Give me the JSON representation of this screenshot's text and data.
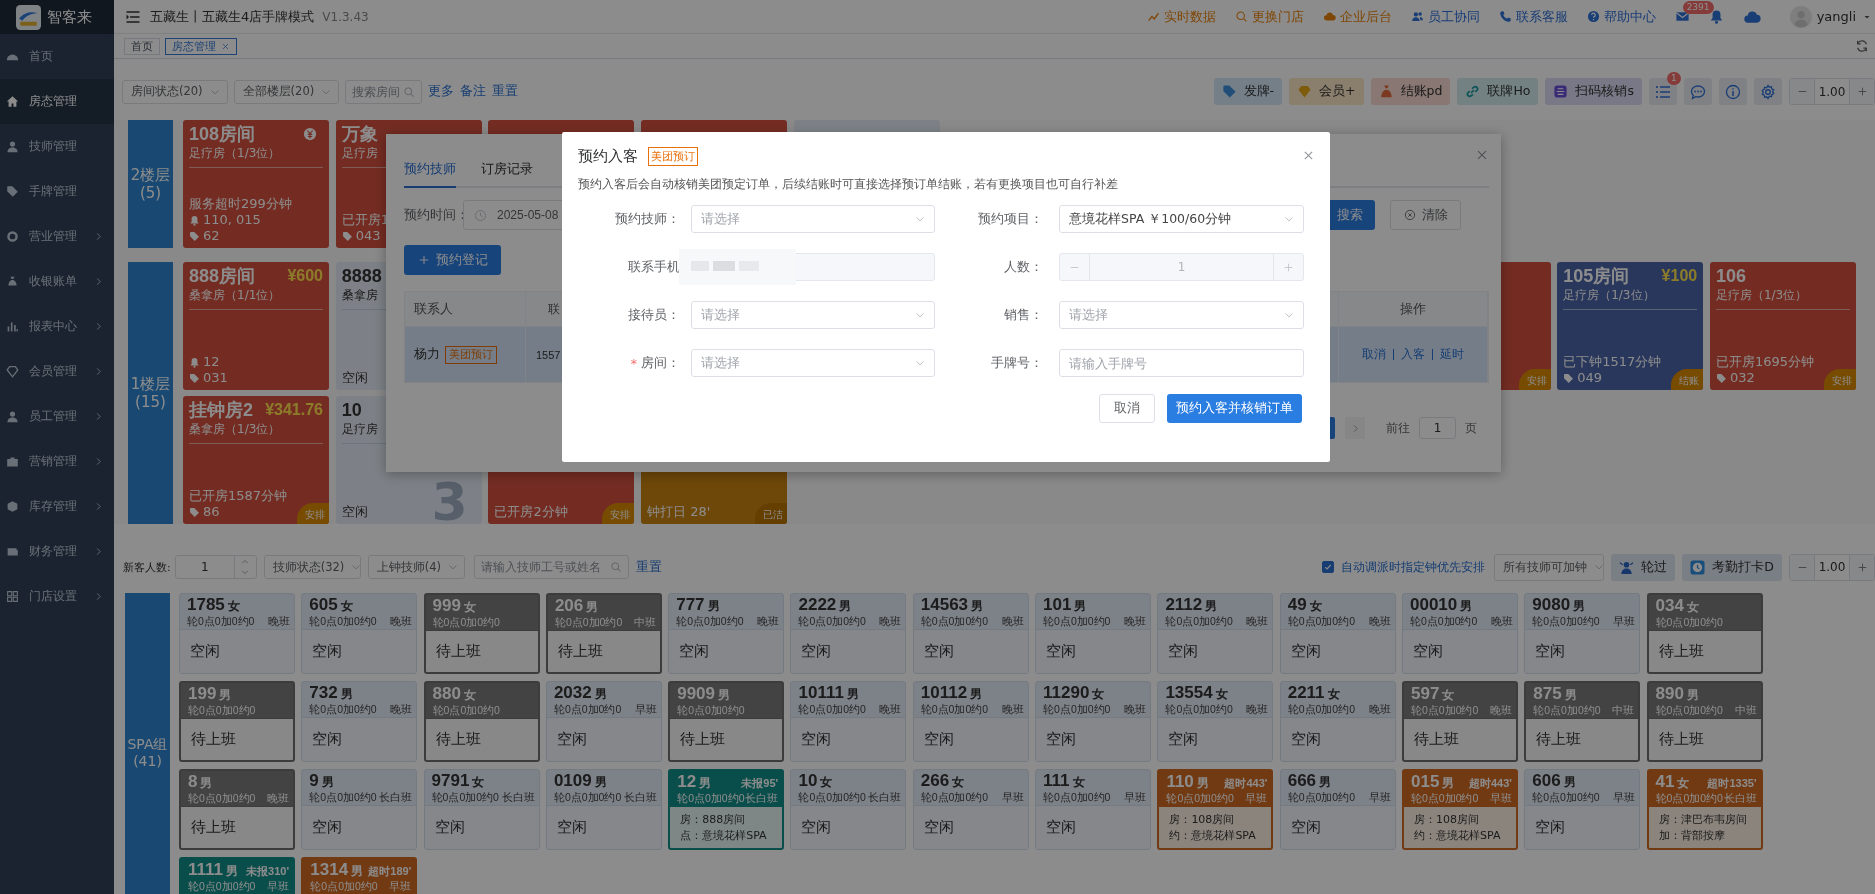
{
  "sidebar": {
    "brand": "智客来",
    "items": [
      {
        "label": "首页",
        "selected": false,
        "expandable": false
      },
      {
        "label": "房态管理",
        "selected": true,
        "expandable": false
      },
      {
        "label": "技师管理",
        "selected": false,
        "expandable": false
      },
      {
        "label": "手牌管理",
        "selected": false,
        "expandable": false
      },
      {
        "label": "营业管理",
        "selected": false,
        "expandable": true
      },
      {
        "label": "收银账单",
        "selected": false,
        "expandable": true
      },
      {
        "label": "报表中心",
        "selected": false,
        "expandable": true
      },
      {
        "label": "会员管理",
        "selected": false,
        "expandable": true
      },
      {
        "label": "员工管理",
        "selected": false,
        "expandable": true
      },
      {
        "label": "营销管理",
        "selected": false,
        "expandable": true
      },
      {
        "label": "库存管理",
        "selected": false,
        "expandable": true
      },
      {
        "label": "财务管理",
        "selected": false,
        "expandable": true
      },
      {
        "label": "门店设置",
        "selected": false,
        "expandable": true
      }
    ]
  },
  "header": {
    "title": "五藏生丨五藏生4店手牌模式",
    "version": "V1.3.43",
    "links": [
      {
        "label": "实时数据"
      },
      {
        "label": "更换门店"
      },
      {
        "label": "企业后台"
      },
      {
        "label": "员工协同"
      },
      {
        "label": "联系客服"
      },
      {
        "label": "帮助中心"
      }
    ],
    "mail_badge": "2391",
    "user": "yangli"
  },
  "tabs": [
    {
      "label": "首页",
      "selected": false,
      "closable": false
    },
    {
      "label": "房态管理",
      "selected": true,
      "closable": true
    }
  ],
  "room_filters": {
    "selects": [
      "房间状态(20)",
      "全部楼层(20)"
    ],
    "search_placeholder": "搜索房间",
    "links": [
      "更多",
      "备注",
      "重置"
    ]
  },
  "room_tools": [
    {
      "label": "发牌-"
    },
    {
      "label": "会员+"
    },
    {
      "label": "结账pd"
    },
    {
      "label": "联牌Ho"
    },
    {
      "label": "扫码核销s"
    }
  ],
  "list_badge": "1",
  "room_zoom": "1.00",
  "floors": [
    {
      "label": "2楼层",
      "count": "(5)",
      "rooms": [
        {
          "kind": "occupied",
          "title": "108房间",
          "coin": true,
          "subtitle": "足疗房（1/3位）",
          "status": "服务超时299分钟",
          "bell": "110, 015",
          "tag": "62"
        },
        {
          "kind": "occupied",
          "title": "万象",
          "subtitle": "足疗房",
          "status": "已开房1",
          "tag": "043"
        },
        {
          "kind": "occupied"
        },
        {
          "kind": "occupied"
        },
        {
          "kind": "free"
        }
      ]
    },
    {
      "label": "1楼层",
      "count": "(15)",
      "rooms": [
        {
          "kind": "occupied",
          "title": "888房间",
          "price": "¥600",
          "subtitle": "桑拿房（1/1位）",
          "bell": "12",
          "tag": "031"
        },
        {
          "kind": "free",
          "title": "8888",
          "subtitle": "桑拿房",
          "status": "空闲"
        },
        {
          "kind": "covered"
        },
        {
          "kind": "covered"
        },
        {
          "kind": "covered"
        },
        {
          "kind": "covered"
        },
        {
          "kind": "covered"
        },
        {
          "kind": "covered"
        },
        {
          "kind": "occupied",
          "corner": "安排"
        },
        {
          "kind": "checkout",
          "title": "105房间",
          "price": "¥100",
          "subtitle": "足疗房（1/3位）",
          "status": "已下钟1517分钟",
          "tag": "049",
          "corner": "结账"
        },
        {
          "kind": "occupied",
          "title": "106",
          "subtitle": "足疗房（1/3位）",
          "status": "已开房1695分钟",
          "tag": "032",
          "corner": "安排"
        },
        {
          "kind": "occupied",
          "title": "挂钟房2",
          "price": "¥341.76",
          "subtitle": "桑拿房（1/3位）",
          "status": "已开房1587分钟",
          "tag": "86",
          "corner": "安排"
        },
        {
          "kind": "free",
          "title": "10",
          "subtitle": "足疗房",
          "status": "空闲",
          "big_number": "3"
        },
        {
          "kind": "occupied",
          "status": "已开房2分钟",
          "corner": "安排"
        },
        {
          "kind": "cleaning",
          "status": "钟打日 28'",
          "corner": "已洁"
        }
      ]
    }
  ],
  "tech_toolbar": {
    "guest_label": "新客人数:",
    "guest_count": "1",
    "selects": [
      "技师状态(32)",
      "上钟技师(4)"
    ],
    "search_placeholder": "请输入技师工号或姓名",
    "reset": "重置",
    "auto_option": {
      "label": "自动调派时指定钟优先安排",
      "checked": true
    },
    "overtime_select": "所有技师可加钟",
    "buttons": [
      "轮过",
      "考勤打卡D"
    ],
    "zoom": "1.00"
  },
  "tech_groups": [
    {
      "label": "SPA组",
      "count": "(41)",
      "techs": [
        {
          "kind": "idle",
          "no": "1785",
          "gender": "女",
          "stats": "轮0点0加0约0",
          "shift": "晚班",
          "status": "空闲"
        },
        {
          "kind": "idle",
          "no": "605",
          "gender": "女",
          "stats": "轮0点0加0约0",
          "shift": "晚班",
          "status": "空闲"
        },
        {
          "kind": "off",
          "no": "999",
          "gender": "女",
          "stats": "轮0点0加0约0",
          "status": "待上班"
        },
        {
          "kind": "off",
          "no": "206",
          "gender": "男",
          "stats": "轮0点0加0约0",
          "shift": "中班",
          "status": "待上班"
        },
        {
          "kind": "idle",
          "no": "777",
          "gender": "男",
          "stats": "轮0点0加0约0",
          "shift": "晚班",
          "status": "空闲"
        },
        {
          "kind": "idle",
          "no": "2222",
          "gender": "男",
          "stats": "轮0点0加0约0",
          "shift": "晚班",
          "status": "空闲"
        },
        {
          "kind": "idle",
          "no": "14563",
          "gender": "男",
          "stats": "轮0点0加0约0",
          "shift": "晚班",
          "status": "空闲"
        },
        {
          "kind": "idle",
          "no": "101",
          "gender": "男",
          "stats": "轮0点0加0约0",
          "shift": "晚班",
          "status": "空闲"
        },
        {
          "kind": "idle",
          "no": "2112",
          "gender": "男",
          "stats": "轮0点0加0约0",
          "shift": "晚班",
          "status": "空闲"
        },
        {
          "kind": "idle",
          "no": "49",
          "gender": "女",
          "stats": "轮0点0加0约0",
          "shift": "晚班",
          "status": "空闲"
        },
        {
          "kind": "idle",
          "no": "00010",
          "gender": "男",
          "stats": "轮0点0加0约0",
          "shift": "晚班",
          "status": "空闲"
        },
        {
          "kind": "idle",
          "no": "9080",
          "gender": "男",
          "stats": "轮0点0加0约0",
          "shift": "早班",
          "status": "空闲"
        },
        {
          "kind": "off",
          "no": "034",
          "gender": "女",
          "stats": "轮0点0加0约0",
          "status": "待上班"
        },
        {
          "kind": "off",
          "no": "199",
          "gender": "男",
          "stats": "轮0点0加0约0",
          "status": "待上班"
        },
        {
          "kind": "idle",
          "no": "732",
          "gender": "男",
          "stats": "轮0点0加0约0",
          "shift": "晚班",
          "status": "空闲"
        },
        {
          "kind": "off",
          "no": "880",
          "gender": "女",
          "stats": "轮0点0加0约0",
          "status": "待上班"
        },
        {
          "kind": "idle",
          "no": "2032",
          "gender": "男",
          "stats": "轮0点0加0约0",
          "shift": "早班",
          "status": "空闲"
        },
        {
          "kind": "off",
          "no": "9909",
          "gender": "男",
          "stats": "轮0点0加0约0",
          "status": "待上班"
        },
        {
          "kind": "idle",
          "no": "10111",
          "gender": "男",
          "stats": "轮0点0加0约0",
          "shift": "晚班",
          "status": "空闲"
        },
        {
          "kind": "idle",
          "no": "10112",
          "gender": "男",
          "stats": "轮0点0加0约0",
          "shift": "晚班",
          "status": "空闲"
        },
        {
          "kind": "idle",
          "no": "11290",
          "gender": "女",
          "stats": "轮0点0加0约0",
          "shift": "晚班",
          "status": "空闲"
        },
        {
          "kind": "idle",
          "no": "13554",
          "gender": "女",
          "stats": "轮0点0加0约0",
          "shift": "晚班",
          "status": "空闲"
        },
        {
          "kind": "idle",
          "no": "2211",
          "gender": "女",
          "stats": "轮0点0加0约0",
          "shift": "晚班",
          "status": "空闲"
        },
        {
          "kind": "off",
          "no": "597",
          "gender": "女",
          "stats": "轮0点0加0约0",
          "shift": "晚班",
          "status": "待上班"
        },
        {
          "kind": "off",
          "no": "875",
          "gender": "男",
          "stats": "轮0点0加0约0",
          "shift": "中班",
          "status": "待上班"
        },
        {
          "kind": "off",
          "no": "890",
          "gender": "男",
          "stats": "轮0点0加0约0",
          "shift": "中班",
          "status": "待上班"
        },
        {
          "kind": "off",
          "no": "8",
          "gender": "男",
          "stats": "轮0点0加0约0",
          "shift": "晚班",
          "status": "待上班"
        },
        {
          "kind": "idle",
          "no": "9",
          "gender": "男",
          "stats": "轮0点0加0约0",
          "shift": "长白班",
          "status": "空闲"
        },
        {
          "kind": "idle",
          "no": "9791",
          "gender": "女",
          "stats": "轮0点0加0约0",
          "shift": "长白班",
          "status": "空闲"
        },
        {
          "kind": "idle",
          "no": "0109",
          "gender": "男",
          "stats": "轮0点0加0约0",
          "shift": "长白班",
          "status": "空闲"
        },
        {
          "kind": "serving",
          "no": "12",
          "gender": "男",
          "alert": "未报95'",
          "stats": "轮0点0加0约0",
          "shift": "长白班",
          "lines": [
            "房：888房间",
            "点：意境花样SPA"
          ]
        },
        {
          "kind": "idle",
          "no": "10",
          "gender": "女",
          "stats": "轮0点0加0约0",
          "shift": "长白班",
          "status": "空闲"
        },
        {
          "kind": "idle",
          "no": "266",
          "gender": "女",
          "stats": "轮0点0加0约0",
          "shift": "早班",
          "status": "空闲"
        },
        {
          "kind": "idle",
          "no": "111",
          "gender": "女",
          "stats": "轮0点0加0约0",
          "shift": "早班",
          "status": "空闲"
        },
        {
          "kind": "overtime",
          "no": "110",
          "gender": "男",
          "alert": "超时443'",
          "stats": "轮0点0加0约0",
          "shift": "早班",
          "lines": [
            "房：108房间",
            "约：意境花样SPA"
          ]
        },
        {
          "kind": "idle",
          "no": "666",
          "gender": "男",
          "stats": "轮0点0加0约0",
          "shift": "早班",
          "status": "空闲"
        },
        {
          "kind": "overtime",
          "no": "015",
          "gender": "男",
          "alert": "超时443'",
          "stats": "轮0点0加0约0",
          "shift": "早班",
          "lines": [
            "房：108房间",
            "约：意境花样SPA"
          ]
        },
        {
          "kind": "idle",
          "no": "606",
          "gender": "男",
          "stats": "轮0点0加0约0",
          "shift": "早班",
          "status": "空闲"
        },
        {
          "kind": "overtime",
          "no": "41",
          "gender": "女",
          "alert": "超时1335'",
          "stats": "轮0点0加0约0",
          "shift": "长白班",
          "lines": [
            "房：津巴布韦房间",
            "加：背部按摩"
          ]
        },
        {
          "kind": "serving",
          "no": "1111",
          "gender": "男",
          "alert": "未报310'",
          "stats": "轮0点0加0约0",
          "shift": "早班"
        },
        {
          "kind": "overtime",
          "no": "1314",
          "gender": "男",
          "alert": "超时189'",
          "stats": "轮0点0加0约0",
          "shift": "早班"
        }
      ]
    }
  ],
  "booking_dialog": {
    "tabs": [
      {
        "label": "预约技师",
        "selected": true
      },
      {
        "label": "订房记录",
        "selected": false
      }
    ],
    "time_label": "预约时间：",
    "time_value": "2025-05-08",
    "search_button": "搜索",
    "clear_button": "清除",
    "add_button": "预约登记",
    "columns": [
      "联系人",
      "联",
      "操作"
    ],
    "rows": [
      {
        "contact": "杨力",
        "tag": "美团预订",
        "phone": "1557",
        "selected": true,
        "actions": [
          "取消",
          "入客",
          "延时"
        ]
      }
    ],
    "pagination": {
      "goto_label": "前往",
      "page": "1",
      "page_suffix": "页"
    }
  },
  "checkin_modal": {
    "title": "预约入客",
    "tag": "美团预订",
    "description": "预约入客后会自动核销美团预定订单，后续结账时可直接选择预订单结账，若有更换项目也可自行补差",
    "fields": [
      {
        "kind": "select",
        "label": "预约技师：",
        "placeholder": "请选择"
      },
      {
        "kind": "select",
        "label": "预约项目：",
        "value": "意境花样SPA ￥100/60分钟"
      },
      {
        "kind": "masked",
        "label": "联系手机"
      },
      {
        "kind": "stepper",
        "label": "人数：",
        "value": "1"
      },
      {
        "kind": "select",
        "label": "接待员：",
        "placeholder": "请选择"
      },
      {
        "kind": "select",
        "label": "销售：",
        "placeholder": "请选择"
      },
      {
        "kind": "select",
        "label": "房间：",
        "required_mark": "*",
        "placeholder": "请选择"
      },
      {
        "kind": "text",
        "label": "手牌号：",
        "placeholder": "请输入手牌号"
      }
    ],
    "buttons": [
      {
        "kind": "default",
        "label": "取消"
      },
      {
        "kind": "primary",
        "label": "预约入客并核销订单"
      }
    ]
  }
}
